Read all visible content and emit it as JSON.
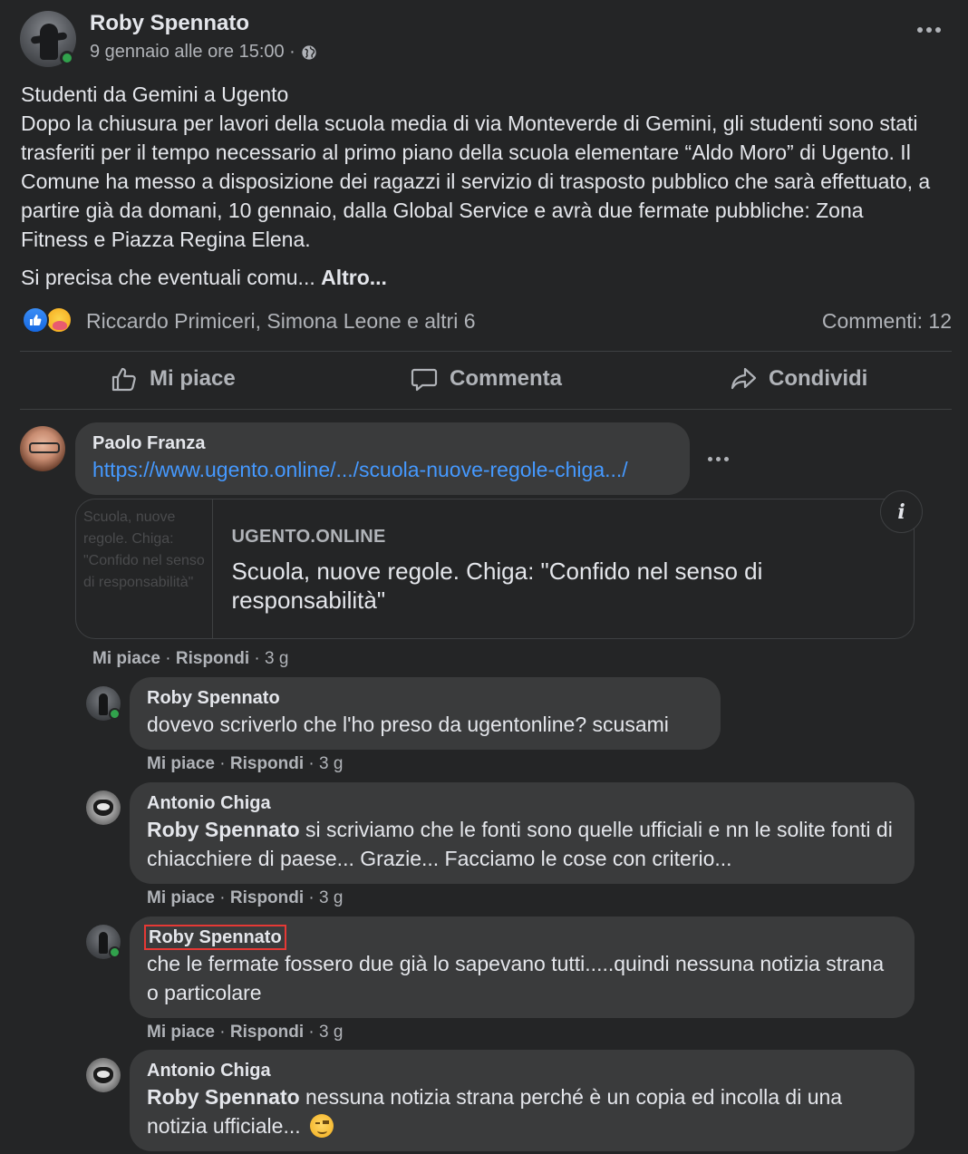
{
  "post": {
    "author": "Roby Spennato",
    "timestamp": "9 gennaio alle ore 15:00 ·",
    "privacy_icon": "globe-icon",
    "title_line": "Studenti da Gemini a Ugento",
    "body": "Dopo la chiusura per lavori della scuola media di via Monteverde di Gemini, gli studenti sono stati trasferiti per il tempo necessario al primo piano della scuola elementare “Aldo Moro” di Ugento. Il Comune ha messo a disposizione dei ragazzi il servizio di trasposto pubblico che sarà effettuato, a partire già da domani, 10 gennaio, dalla Global Service e avrà due fermate pubbliche: Zona Fitness e Piazza Regina Elena.",
    "truncated": "Si precisa che eventuali comu...",
    "more_label": "Altro...",
    "reactors": "Riccardo Primiceri, Simona Leone e altri 6",
    "comments_count": "Commenti: 12"
  },
  "actions": {
    "like": "Mi piace",
    "comment": "Commenta",
    "share": "Condividi"
  },
  "comments": [
    {
      "author": "Paolo Franza",
      "link": "https://www.ugento.online/.../scuola-nuove-regole-chiga.../",
      "preview": {
        "thumb_alt": "Scuola, nuove regole. Chiga: \"Confido nel senso di responsabilità\"",
        "domain": "UGENTO.ONLINE",
        "title": "Scuola, nuove regole. Chiga: \"Confido nel senso di responsabilità\""
      },
      "like": "Mi piace",
      "reply": "Rispondi",
      "age": "3 g"
    },
    {
      "author": "Roby Spennato",
      "text": "dovevo scriverlo che l'ho preso da ugentonline? scusami",
      "like": "Mi piace",
      "reply": "Rispondi",
      "age": "3 g"
    },
    {
      "author": "Antonio Chiga",
      "tag": "Roby Spennato",
      "text": " si scriviamo che le fonti sono quelle ufficiali e nn le solite fonti di chiacchiere di paese... Grazie... Facciamo le cose con criterio...",
      "like": "Mi piace",
      "reply": "Rispondi",
      "age": "3 g"
    },
    {
      "author": "Roby Spennato",
      "text": "che le fermate fossero due già lo sapevano tutti.....quindi nessuna notizia strana o particolare",
      "like": "Mi piace",
      "reply": "Rispondi",
      "age": "3 g"
    },
    {
      "author": "Antonio Chiga",
      "tag": "Roby Spennato",
      "text": " nessuna notizia strana perché è un copia ed incolla di una notizia ufficiale... ",
      "emoji": "wink-emoji"
    }
  ],
  "colors": {
    "background": "#242526",
    "bubble": "#3a3b3c",
    "link": "#4599ff",
    "like_reaction": "#1669e3",
    "online": "#31a24c",
    "highlight_box": "#e53935"
  }
}
